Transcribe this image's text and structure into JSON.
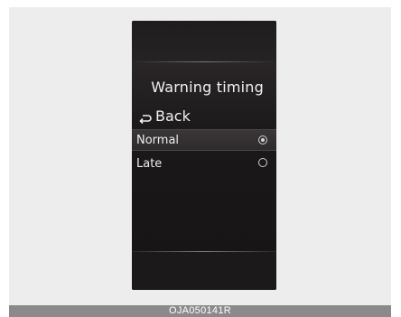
{
  "screen": {
    "title": "Warning timing",
    "back_label": "Back",
    "options": [
      {
        "label": "Normal",
        "selected": true
      },
      {
        "label": "Late",
        "selected": false
      }
    ]
  },
  "caption": {
    "code": "OJA050141R"
  },
  "icons": {
    "back": "back-arrow-icon",
    "radio_on": "radio-selected-icon",
    "radio_off": "radio-unselected-icon"
  },
  "colors": {
    "panel_background": "#1c1a1b",
    "text": "#f2f2f2",
    "caption_bar": "#8a8a8a",
    "frame_background": "#ededed"
  }
}
